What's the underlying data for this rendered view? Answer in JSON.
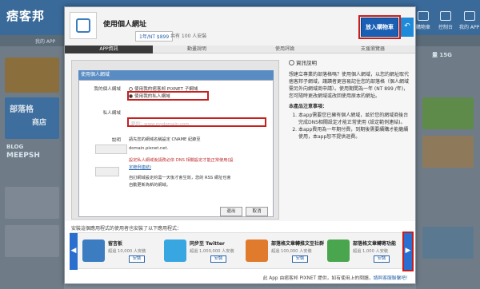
{
  "background": {
    "logo": "痞客邦",
    "my_app": "我的 APP",
    "nav": [
      "購物車",
      "控制台",
      "我的 APP"
    ],
    "side_text_1": "部落格",
    "side_text_2": "商店",
    "side_text_3": "BLOG",
    "side_text_4": "MEEPSH",
    "right_text": "量 15G"
  },
  "app": {
    "title": "使用個人網址",
    "price": "1年/NT $899",
    "installs": "共有 100 人安裝",
    "buy_label": "放入購物車",
    "share_icon": "share-icon"
  },
  "tabs": [
    {
      "label": "APP資訊",
      "active": true
    },
    {
      "label": "動畫說明",
      "active": false
    },
    {
      "label": "使用評論",
      "active": false
    },
    {
      "label": "支援瀏覽器",
      "active": false
    }
  ],
  "screenshot": {
    "window_title": "使用個人網域",
    "my_domain_label": "我的個人網域",
    "radio_1": "使用我的痞客邦 PIXNET 子網域",
    "radio_2": "使用我的私人網域",
    "private_label": "私人網域",
    "placeholder": "範例：www.mydomain.com",
    "desc_label": "說明",
    "desc_1": "請先您的網域名稱設定 CNAME 紀錄至",
    "desc_2": "domain.pixnet.net.",
    "desc_3": "設定私人網域後請務必依 DNS 相關設定才能正常使用(設",
    "desc_4": "定範例連結)",
    "desc_5": "自訂網域設定約需一天後才會生效，您的 RSS 網址也會",
    "desc_6": "自動更新為新的網域。",
    "btn_back": "退出",
    "btn_cancel": "取消"
  },
  "info": {
    "header": "資訊說明",
    "intro": "想建立專業的部落格嗎？使用個人網域，以您的網址取代痞客邦子網域，讓讀者更容易記住您的部落格（個人網域需另外向網域商申請）。使用期間為一年 (NT 899 /年)，您可隨時更改網域或改回使用原本的網址。",
    "heading": "本產品注意事項：",
    "items": [
      "本app需要您已擁有個人網域，並於您的網域商後台完成DNS相關設定才能正常使用 (設定範例連結)。",
      "本app費用為一年期付費，到期後需要續購才能繼續使用，本app恕不提供退費。"
    ],
    "link_text": "設定範例連結"
  },
  "footer": {
    "caption": "安裝這個應用程式的使用者也安裝了以下應用程式：",
    "recs": [
      {
        "name": "留言板",
        "stat": "超過 10,000 人安裝",
        "install": "安裝",
        "color": "#3b7dc0"
      },
      {
        "name": "同步至 Twitter",
        "stat": "超過 1,000,000 人安裝",
        "install": "安裝",
        "color": "#38a6e0"
      },
      {
        "name": "部落格文章轉推文至社群",
        "stat": "超過 100,000 人安裝",
        "install": "安裝",
        "color": "#e07a2c"
      },
      {
        "name": "部落格文章轉寄功能",
        "stat": "超過 1,000 人安裝",
        "install": "安裝",
        "color": "#4aa64e"
      }
    ],
    "note": "此 App 由痞客邦 PIXNET 提供，如有使用上的問題，",
    "note_link": "請與客服聯繫吧！"
  }
}
